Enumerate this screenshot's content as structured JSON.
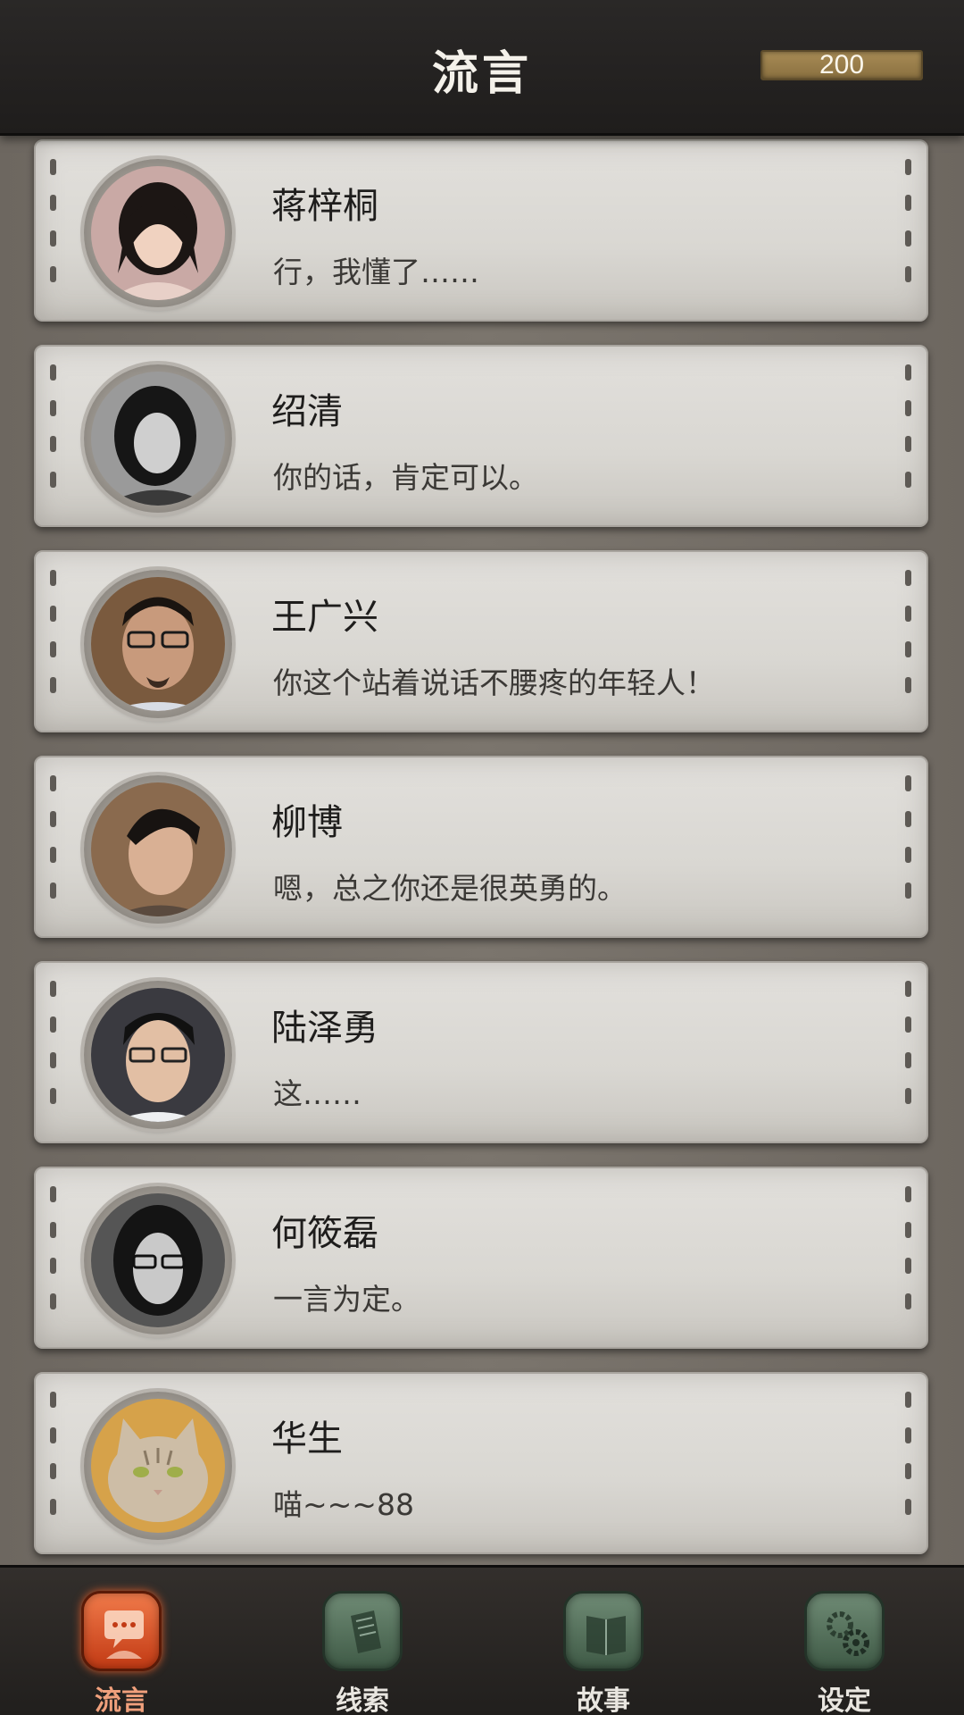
{
  "header": {
    "title": "流言",
    "currency": "200"
  },
  "contacts": [
    {
      "name": "蒋梓桐",
      "message": "行，我懂了……",
      "avatar": "woman-long-dark-hair-avatar"
    },
    {
      "name": "绍清",
      "message": "你的话，肯定可以。",
      "avatar": "woman-black-white-avatar"
    },
    {
      "name": "王广兴",
      "message": "你这个站着说话不腰疼的年轻人！",
      "avatar": "man-glasses-goatee-avatar"
    },
    {
      "name": "柳博",
      "message": "嗯，总之你还是很英勇的。",
      "avatar": "man-slicked-hair-avatar"
    },
    {
      "name": "陆泽勇",
      "message": "这……",
      "avatar": "man-glasses-avatar"
    },
    {
      "name": "何筱磊",
      "message": "一言为定。",
      "avatar": "man-long-hair-glasses-avatar"
    },
    {
      "name": "华生",
      "message": "喵~~~88",
      "avatar": "tabby-cat-avatar"
    }
  ],
  "nav": [
    {
      "label": "流言",
      "icon": "chat-bubble-icon",
      "active": true
    },
    {
      "label": "线索",
      "icon": "documents-icon",
      "active": false
    },
    {
      "label": "故事",
      "icon": "book-icon",
      "active": false
    },
    {
      "label": "设定",
      "icon": "gears-icon",
      "active": false
    }
  ],
  "colors": {
    "active_tab": "#d24a1e",
    "inactive_tab": "#4f6b56",
    "header_bg": "#252322",
    "card_bg": "#dedcd8"
  }
}
